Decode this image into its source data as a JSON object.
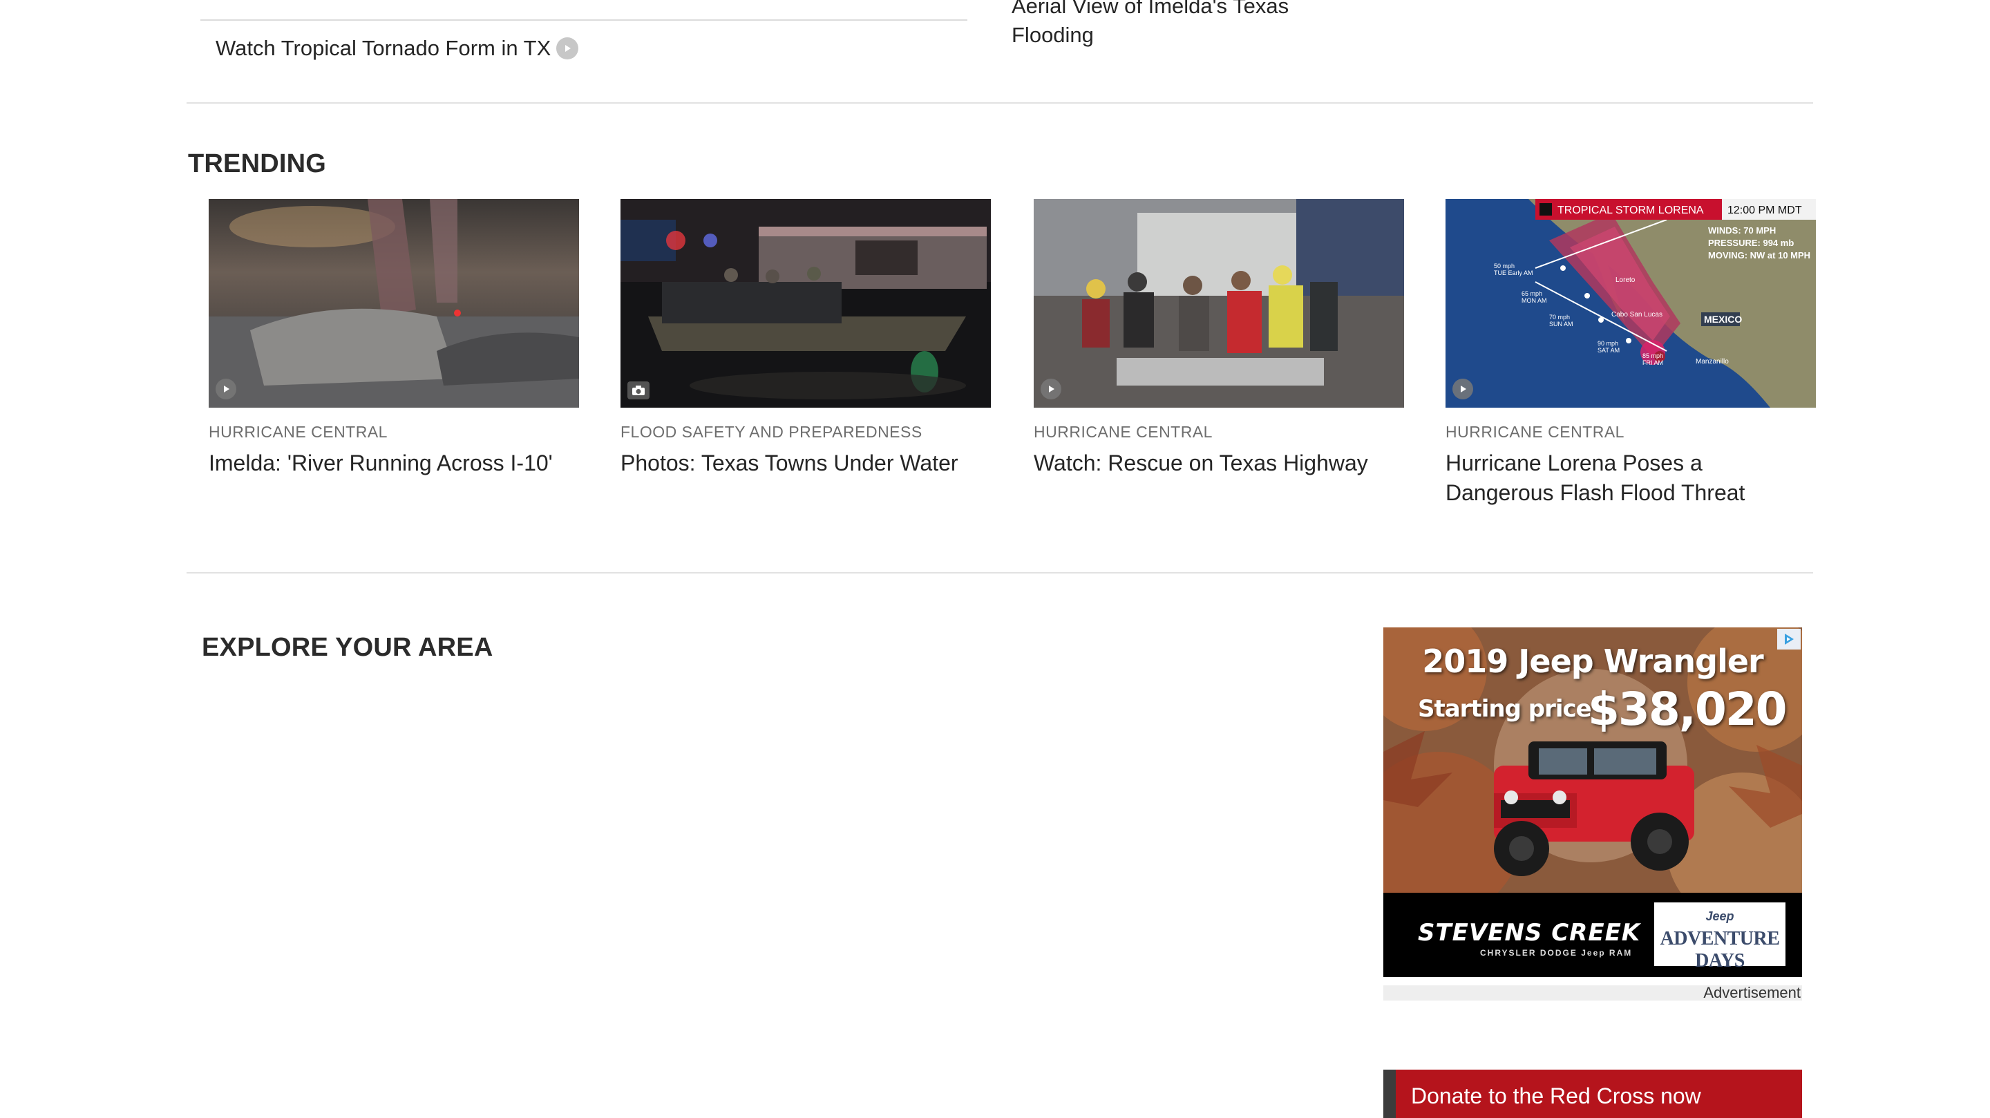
{
  "top_links": {
    "left_item": "Watch Tropical Tornado Form in TX",
    "right_item": "Aerial View of Imelda's Texas Flooding"
  },
  "trending": {
    "title": "TRENDING",
    "cards": [
      {
        "category": "HURRICANE CENTRAL",
        "title": "Imelda: 'River Running Across I-10'",
        "media": "video-icon"
      },
      {
        "category": "FLOOD SAFETY AND PREPAREDNESS",
        "title": "Photos: Texas Towns Under Water",
        "media": "camera-icon"
      },
      {
        "category": "HURRICANE CENTRAL",
        "title": "Watch: Rescue on Texas Highway",
        "media": "video-icon"
      },
      {
        "category": "HURRICANE CENTRAL",
        "title": "Hurricane Lorena Poses a Dangerous Flash Flood Threat",
        "media": "video-icon"
      }
    ],
    "map_overlay": {
      "storm_label": "TROPICAL STORM LORENA",
      "time": "12:00 PM MDT",
      "winds": "WINDS: 70 MPH",
      "pressure": "PRESSURE: 994 mb",
      "moving": "MOVING: NW at 10 MPH",
      "country": "MEXICO",
      "place1": "Cabo San Lucas",
      "place2": "Manzanillo",
      "place3": "Loreto",
      "p1": "50 mph",
      "p1t": "TUE Early AM",
      "p2": "65 mph",
      "p2t": "MON AM",
      "p3": "70 mph",
      "p3t": "SUN AM",
      "p4": "90 mph",
      "p4t": "SAT AM",
      "p5": "85 mph",
      "p5t": "FRI AM"
    }
  },
  "explore": {
    "title": "EXPLORE YOUR AREA"
  },
  "ad": {
    "headline": "2019 Jeep Wrangler",
    "starting_label": "Starting price",
    "price": "$38,020",
    "dealer": "STEVENS CREEK",
    "brands": "CHRYSLER  DODGE  Jeep  RAM",
    "logo_top": "Jeep",
    "logo_main": "ADVENTURE DAYS",
    "label": "Advertisement"
  },
  "donate": {
    "label": "Donate to the Red Cross now"
  },
  "colors": {
    "accent_red": "#b5141c",
    "rule": "#e2e2e2",
    "category_gray": "#6e6e6e"
  }
}
